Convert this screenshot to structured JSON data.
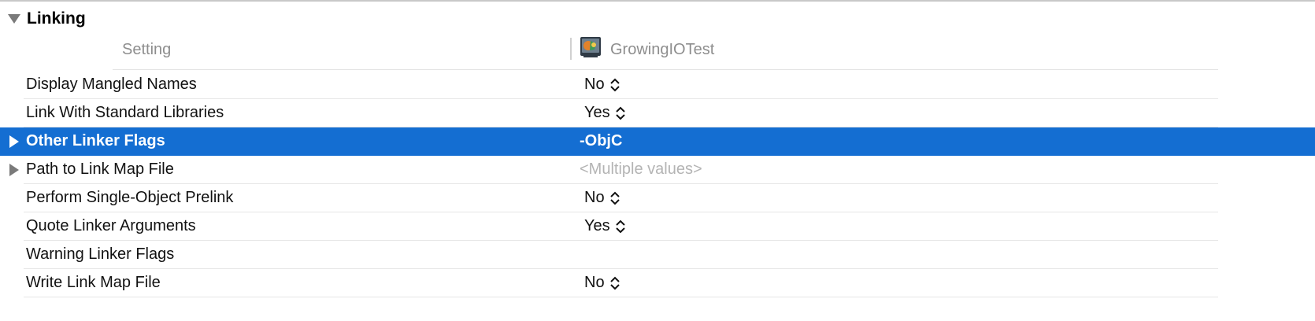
{
  "section": {
    "title": "Linking"
  },
  "columns": {
    "setting": "Setting",
    "target": "GrowingIOTest"
  },
  "rows": [
    {
      "name": "Display Mangled Names",
      "value": "No",
      "stepper": true
    },
    {
      "name": "Link With Standard Libraries",
      "value": "Yes",
      "stepper": true
    },
    {
      "name": "Other Linker Flags",
      "value": "-ObjC",
      "stepper": false,
      "expandable": true,
      "selected": true
    },
    {
      "name": "Path to Link Map File",
      "value": "<Multiple values>",
      "stepper": false,
      "expandable": true
    },
    {
      "name": "Perform Single-Object Prelink",
      "value": "No",
      "stepper": true
    },
    {
      "name": "Quote Linker Arguments",
      "value": "Yes",
      "stepper": true
    },
    {
      "name": "Warning Linker Flags",
      "value": "",
      "stepper": false
    },
    {
      "name": "Write Link Map File",
      "value": "No",
      "stepper": true
    }
  ],
  "colors": {
    "selection": "#146ed2",
    "placeholder": "#b4b4b4",
    "header_text": "#8e8e8e"
  },
  "icons": {
    "section_toggle": "disclosure-triangle-down-icon",
    "row_expand": "disclosure-triangle-right-icon",
    "value_stepper": "up-down-chevron-icon",
    "target": "app-target-icon"
  }
}
